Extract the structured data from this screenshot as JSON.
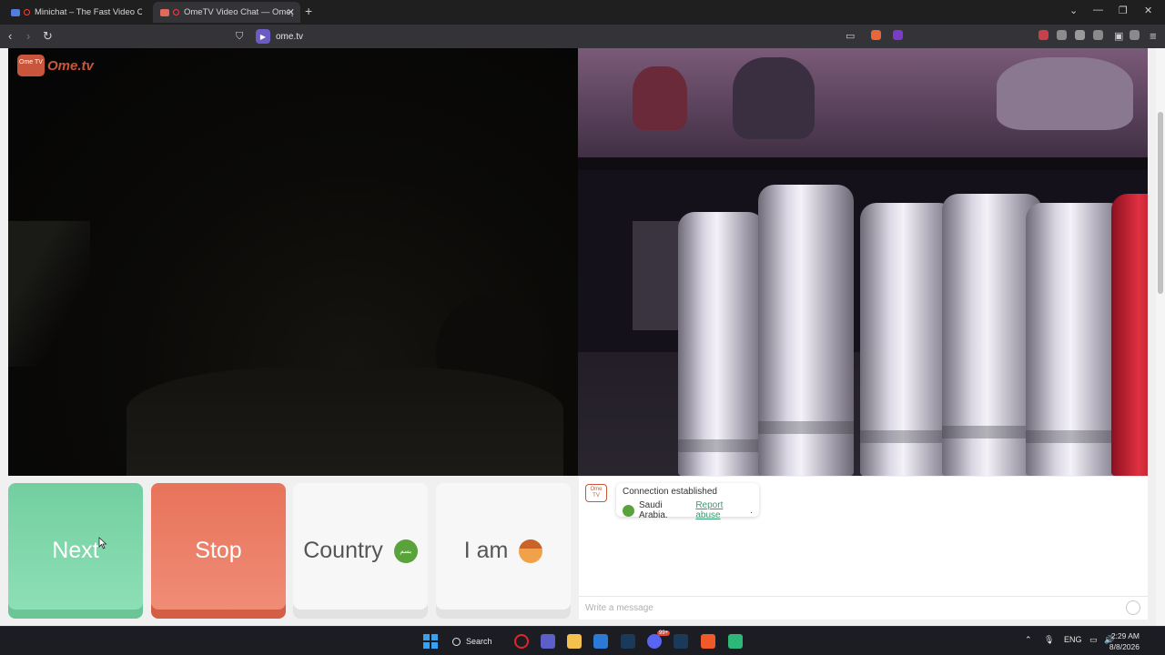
{
  "browser": {
    "tabs": [
      {
        "title": "Minichat – The Fast Video Chat",
        "active": false
      },
      {
        "title": "OmeTV Video Chat — Omegle",
        "active": true
      }
    ],
    "new_tab": "+",
    "url": "ome.tv"
  },
  "site": {
    "logo_badge": "Ome TV",
    "logo_text": "Ome.tv"
  },
  "controls": {
    "next_label": "Next",
    "stop_label": "Stop",
    "country_label": "Country",
    "country_flag_text": "بسم",
    "iam_label": "I am"
  },
  "chat": {
    "logo_badge": "Ome TV",
    "status_line": "Connection established",
    "country": "Saudi Arabia.",
    "report_link": "Report abuse",
    "report_suffix": ".",
    "input_placeholder": "Write a message"
  },
  "taskbar": {
    "search_label": "Search",
    "language": "ENG",
    "time": "2:29 AM",
    "date": "8/8/2026",
    "notification_badge": "99+"
  },
  "colors": {
    "next": "#72cfa0",
    "stop": "#e8735a",
    "brand": "#c9563c",
    "link": "#3a9a72"
  }
}
